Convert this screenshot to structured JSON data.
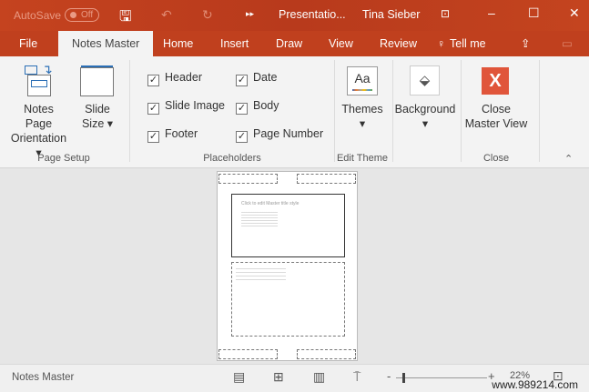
{
  "titlebar": {
    "autosave": "AutoSave",
    "toggle": "Off",
    "document": "Presentatio...",
    "user": "Tina Sieber"
  },
  "tabs": [
    "File",
    "Notes Master",
    "Home",
    "Insert",
    "Draw",
    "View",
    "Review",
    "Tell me"
  ],
  "ribbon": {
    "page_setup": {
      "orientation": "Notes Page",
      "orientation2": "Orientation",
      "slide_size": "Slide",
      "slide_size2": "Size",
      "group": "Page Setup"
    },
    "placeholders": {
      "items": [
        {
          "label": "Header",
          "checked": true
        },
        {
          "label": "Slide Image",
          "checked": true
        },
        {
          "label": "Footer",
          "checked": true
        },
        {
          "label": "Date",
          "checked": true
        },
        {
          "label": "Body",
          "checked": true
        },
        {
          "label": "Page Number",
          "checked": true
        }
      ],
      "group": "Placeholders"
    },
    "edit_theme": {
      "themes": "Themes",
      "background": "Background",
      "group": "Edit Theme",
      "aa": "Aa"
    },
    "close": {
      "close1": "Close",
      "close2": "Master View",
      "group": "Close"
    }
  },
  "page": {
    "slide_title": "Click to edit Master title style"
  },
  "status": {
    "view": "Notes Master",
    "zoom": "22%",
    "zoom_percent": 22,
    "watermark": "www.989214.com"
  },
  "colors": {
    "accent": "#c0401e",
    "close_red": "#e0553a"
  }
}
